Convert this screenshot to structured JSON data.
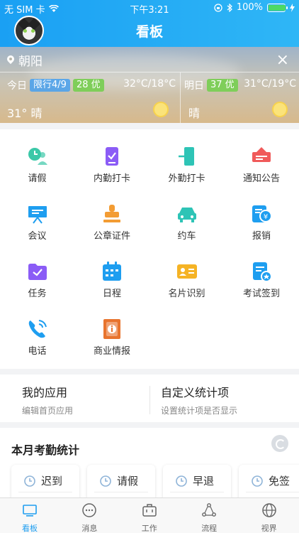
{
  "status_bar": {
    "carrier": "无 SIM 卡",
    "time": "下午3:21",
    "battery": "100%",
    "battery_level": 1.0
  },
  "header": {
    "title": "看板"
  },
  "weather": {
    "location": "朝阳",
    "today": {
      "label": "今日",
      "limit": "限行4/9",
      "aqi": "28 优",
      "temp_range": "32°C/18°C",
      "current_temp": "31°",
      "condition": "晴"
    },
    "tomorrow": {
      "label": "明日",
      "aqi": "37 优",
      "temp_range": "31°C/19°C",
      "condition": "晴"
    }
  },
  "grid": [
    {
      "label": "请假",
      "icon": "leave-icon",
      "color": "#3cc8a8"
    },
    {
      "label": "内勤打卡",
      "icon": "indoor-checkin-icon",
      "color": "#8b5cf6"
    },
    {
      "label": "外勤打卡",
      "icon": "outdoor-checkin-icon",
      "color": "#2ec4b6"
    },
    {
      "label": "通知公告",
      "icon": "announcement-icon",
      "color": "#f05a5a"
    },
    {
      "label": "会议",
      "icon": "meeting-icon",
      "color": "#1e9ef0"
    },
    {
      "label": "公章证件",
      "icon": "seal-icon",
      "color": "#f39c33"
    },
    {
      "label": "约车",
      "icon": "car-icon",
      "color": "#2ec4b6"
    },
    {
      "label": "报销",
      "icon": "reimburse-icon",
      "color": "#1e9ef0"
    },
    {
      "label": "任务",
      "icon": "task-icon",
      "color": "#8b5cf6"
    },
    {
      "label": "日程",
      "icon": "calendar-icon",
      "color": "#1e9ef0"
    },
    {
      "label": "名片识别",
      "icon": "business-card-icon",
      "color": "#f5b325"
    },
    {
      "label": "考试签到",
      "icon": "exam-signin-icon",
      "color": "#1e9ef0"
    },
    {
      "label": "电话",
      "icon": "phone-icon",
      "color": "#1e9ef0"
    },
    {
      "label": "商业情报",
      "icon": "business-intel-icon",
      "color": "#e8742e"
    }
  ],
  "apps": {
    "mine_title": "我的应用",
    "mine_sub": "编辑首页应用",
    "stats_title": "自定义统计项",
    "stats_sub": "设置统计项是否显示"
  },
  "attendance": {
    "title": "本月考勤统计",
    "items": [
      "迟到",
      "请假",
      "早退",
      "免签"
    ]
  },
  "tabbar": [
    {
      "label": "看板",
      "icon": "dashboard-icon"
    },
    {
      "label": "消息",
      "icon": "message-icon"
    },
    {
      "label": "工作",
      "icon": "work-icon"
    },
    {
      "label": "流程",
      "icon": "flow-icon"
    },
    {
      "label": "视界",
      "icon": "globe-icon"
    }
  ],
  "colors": {
    "primary": "#1e9ef0",
    "accent_green": "#7fce5a"
  }
}
